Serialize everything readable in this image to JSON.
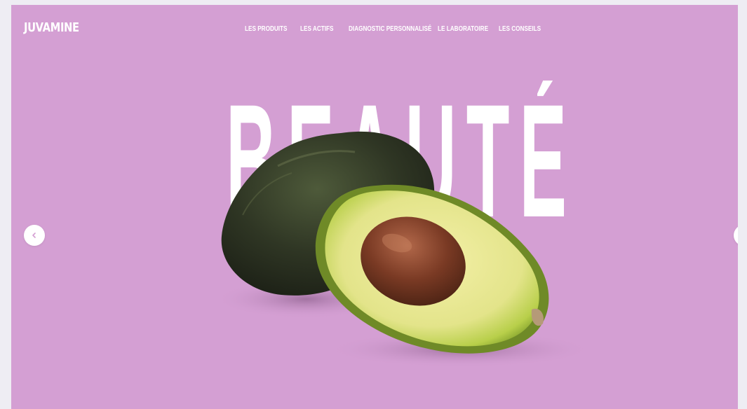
{
  "brand": {
    "logo_text": "JUVAMINE"
  },
  "nav": {
    "items": [
      "LES PRODUITS",
      "LES ACTIFS",
      "DIAGNOSTIC PERSONNALISÉ",
      "LE LABORATOIRE",
      "LES CONSEILS"
    ]
  },
  "hero": {
    "headline": "BEAUTÉ",
    "background_color": "#d49fd3",
    "text_color": "#ffffff"
  },
  "carousel": {
    "prev_icon": "chevron-left-icon",
    "next_icon": "chevron-right-icon"
  }
}
